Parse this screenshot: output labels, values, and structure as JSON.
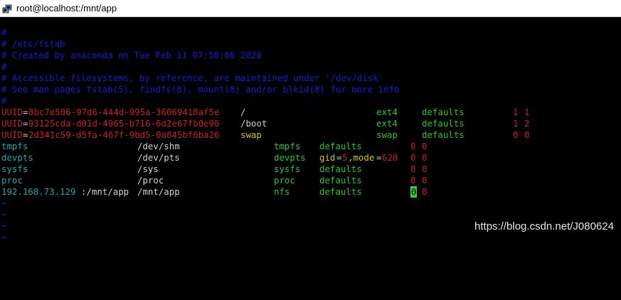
{
  "window": {
    "title": "root@localhost:/mnt/app",
    "icon": "putty-terminal-icon"
  },
  "colors": {
    "comment": "#1a1ad6",
    "uuid_value": "#c8201c",
    "keyword": "#28c428",
    "device": "#1aa7a7",
    "path_swap": "#c8c818",
    "text": "#d0d0d0",
    "cursor": "#28d028"
  },
  "lines": {
    "l1": "#",
    "l2": "# /etc/fstab",
    "l3": "# Created by anaconda on Tue Feb 11 07:50:06 2020",
    "l4": "#",
    "l5": "# Accessible filesystems, by reference, are maintained under '/dev/disk'",
    "l6": "# See man pages fstab(5), findfs(8), mount(8) and/or blkid(8) for more info",
    "l7": "#"
  },
  "entries": {
    "e1": {
      "key": "UUID",
      "eq": "=",
      "id": "8bc7e506-97d6-444d-995a-36069418af5e",
      "mount": "/",
      "type": "ext4",
      "opts": "defaults",
      "d1": "1",
      "d2": "1"
    },
    "e2": {
      "key": "UUID",
      "eq": "=",
      "id": "93125cda-d01d-4965-b716-6d2e67fb0e96",
      "mount": "/boot",
      "type": "ext4",
      "opts": "defaults",
      "d1": "1",
      "d2": "2"
    },
    "e3": {
      "key": "UUID",
      "eq": "=",
      "id": "2d341c59-d5fa-467f-9bd5-0a845bf6ba26",
      "mount": "swap",
      "type": "swap",
      "opts": "defaults",
      "d1": "0",
      "d2": "0"
    },
    "e4": {
      "dev": "tmpfs",
      "mount": "/dev/shm",
      "type": "tmpfs",
      "opts": "defaults",
      "d1": "0",
      "d2": "0"
    },
    "e5": {
      "dev": "devpts",
      "mount": "/dev/pts",
      "type": "devpts",
      "opt_a": "gid",
      "opt_eq1": "=",
      "opt_b": "5",
      "opt_c": ",mode",
      "opt_eq2": "=",
      "opt_d": "620",
      "d1": "0",
      "d2": "0"
    },
    "e6": {
      "dev": "sysfs",
      "mount": "/sys",
      "type": "sysfs",
      "opts": "defaults",
      "d1": "0",
      "d2": "0"
    },
    "e7": {
      "dev": "proc",
      "mount": "/proc",
      "type": "proc",
      "opts": "defaults",
      "d1": "0",
      "d2": "0"
    },
    "e8": {
      "dev": "192.168.73.129",
      "dev_rest": ":/mnt/app",
      "mount": "/mnt/app",
      "type": "nfs",
      "opts": "defaults",
      "d1": "0",
      "d2": "0"
    }
  },
  "tildes": [
    "~",
    "~",
    "~",
    "~"
  ],
  "watermark": "https://blog.csdn.net/J080624"
}
